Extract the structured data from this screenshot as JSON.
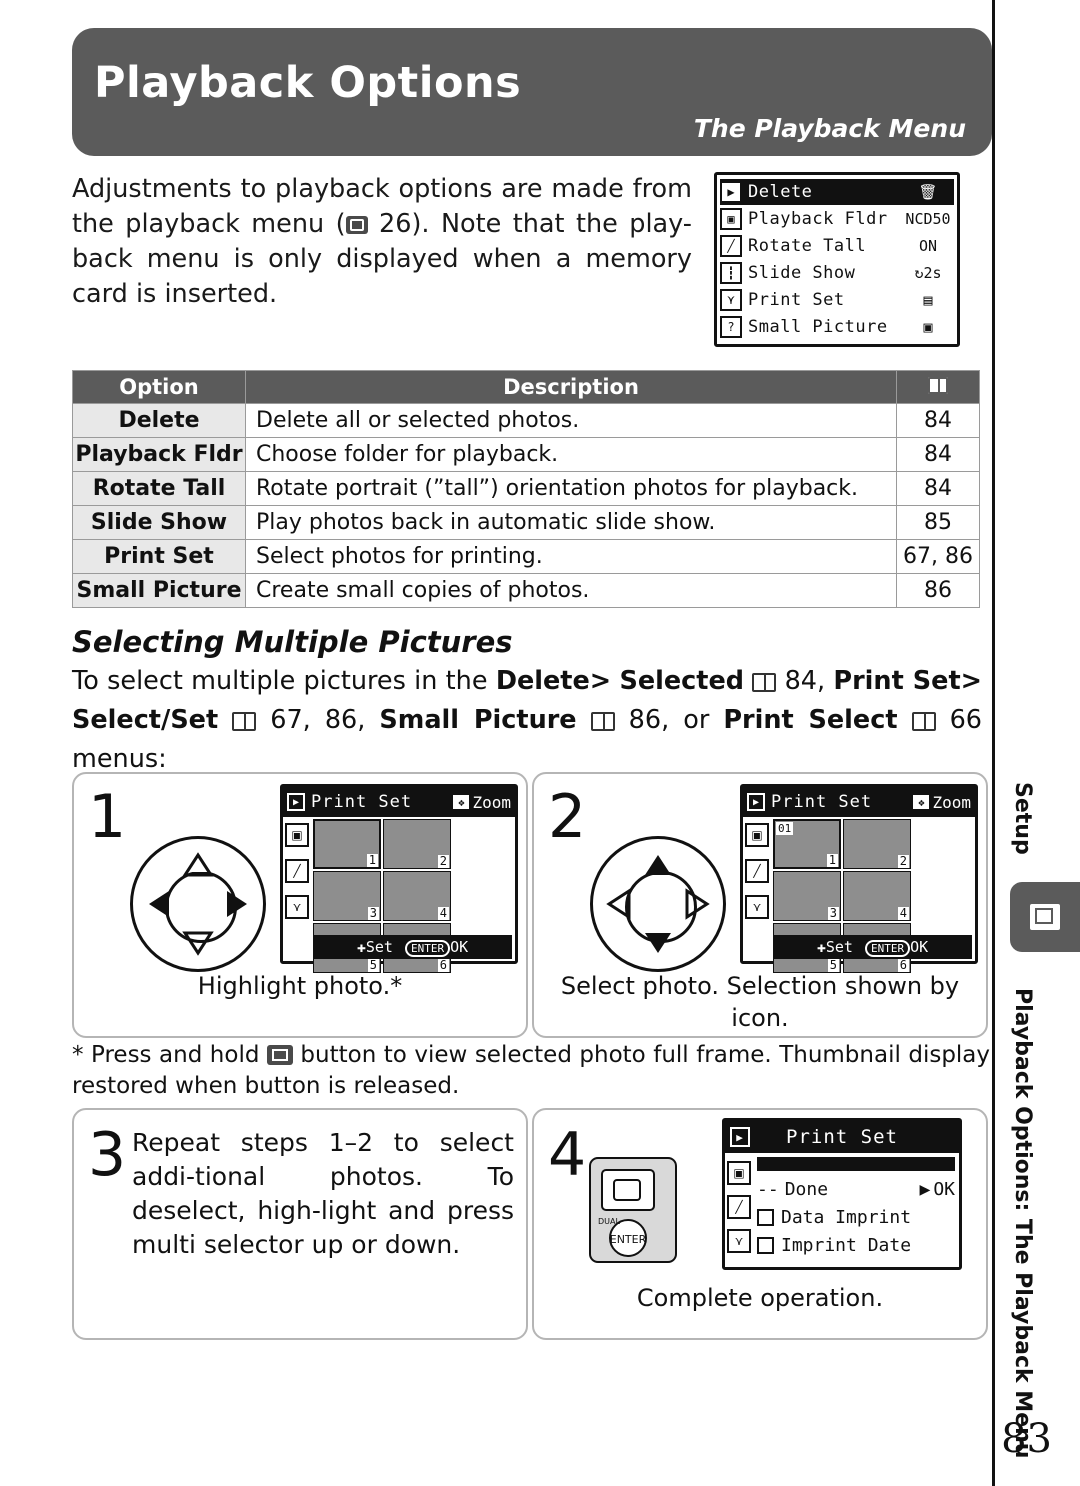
{
  "header": {
    "title": "Playback Options",
    "subtitle": "The Playback Menu"
  },
  "intro": {
    "text_before": "Adjustments to playback options are made from the playback menu (",
    "icon": "book-icon",
    "page_ref": "26",
    "text_after": ").  Note that the play-back menu is only displayed when a memory card is inserted."
  },
  "lcd_menu": {
    "rows": [
      {
        "icon": "playback-icon",
        "label": "Delete",
        "value": "trash",
        "selected": true
      },
      {
        "icon": "camera-icon",
        "label": "Playback Fldr",
        "value": "NCD50",
        "selected": false
      },
      {
        "icon": "pencil-icon",
        "label": "Rotate Tall",
        "value": "ON",
        "selected": false
      },
      {
        "icon": "menu-icon",
        "label": "Slide Show",
        "value": "2s",
        "selected": false
      },
      {
        "icon": "wrench-icon",
        "label": "Print Set",
        "value": "printer",
        "selected": false
      },
      {
        "icon": "question-icon",
        "label": "Small Picture",
        "value": "small",
        "selected": false
      }
    ]
  },
  "table": {
    "headers": {
      "option": "Option",
      "description": "Description",
      "page": "book-icon"
    },
    "rows": [
      {
        "option": "Delete",
        "description": "Delete all or selected photos.",
        "page": "84"
      },
      {
        "option": "Playback Fldr",
        "description": "Choose folder for playback.",
        "page": "84"
      },
      {
        "option": "Rotate Tall",
        "description": "Rotate portrait (”tall”) orientation photos for playback.",
        "page": "84"
      },
      {
        "option": "Slide Show",
        "description": "Play photos back in automatic slide show.",
        "page": "85"
      },
      {
        "option": "Print Set",
        "description": "Select photos for printing.",
        "page": "67, 86"
      },
      {
        "option": "Small Picture",
        "description": "Create small copies of photos.",
        "page": "86"
      }
    ]
  },
  "section": {
    "heading": "Selecting Multiple Pictures",
    "body_p1": "To select multiple pictures in the ",
    "b1": "Delete",
    "gt1": ">",
    "b2": "Selected",
    "pg1": "84",
    "b3": "Print Set",
    "gt2": ">",
    "b4": "Select/Set",
    "pg2": "67, 86",
    "b5": "Small Picture",
    "pg3": "86",
    "or_text": ", or ",
    "b6": "Print Select",
    "pg4": "66",
    "tail": "menus:"
  },
  "steps": [
    {
      "number": "1",
      "caption": "Highlight photo.*",
      "lcd": {
        "title": "Print Set",
        "zoom": "Zoom",
        "set_label": "Set",
        "enter_label": "ENTER",
        "ok_label": "OK",
        "thumbs": [
          {
            "n": "1",
            "badge": "",
            "selected": true
          },
          {
            "n": "2",
            "badge": "",
            "selected": false
          },
          {
            "n": "3",
            "badge": "",
            "selected": false
          },
          {
            "n": "4",
            "badge": "",
            "selected": false
          },
          {
            "n": "5",
            "badge": "",
            "selected": false
          },
          {
            "n": "6",
            "badge": "",
            "selected": false
          }
        ]
      }
    },
    {
      "number": "2",
      "caption": "Select photo.  Selection shown by icon.",
      "lcd": {
        "title": "Print Set",
        "zoom": "Zoom",
        "set_label": "Set",
        "enter_label": "ENTER",
        "ok_label": "OK",
        "thumbs": [
          {
            "n": "1",
            "badge": "01",
            "selected": true
          },
          {
            "n": "2",
            "badge": "",
            "selected": false
          },
          {
            "n": "3",
            "badge": "",
            "selected": false
          },
          {
            "n": "4",
            "badge": "",
            "selected": false
          },
          {
            "n": "5",
            "badge": "",
            "selected": false
          },
          {
            "n": "6",
            "badge": "",
            "selected": false
          }
        ]
      }
    },
    {
      "number": "3",
      "caption": "",
      "text": "Repeat steps 1–2 to select addi-tional photos.  To deselect, high-light and press multi selector up or down."
    },
    {
      "number": "4",
      "caption": "Complete operation.",
      "lcd": {
        "title": "Print Set",
        "rows": [
          {
            "label": "Done",
            "mark": "--",
            "right": "OK",
            "checkbox": false
          },
          {
            "label": "Data Imprint",
            "mark": "",
            "right": "",
            "checkbox": true
          },
          {
            "label": "Imprint Date",
            "mark": "",
            "right": "",
            "checkbox": true
          }
        ],
        "enter_label": "ENTER"
      }
    }
  ],
  "footnote": {
    "star": "*",
    "text_before": "Press and hold ",
    "icon": "thumbnail-button-icon",
    "text_after": " button to view selected photo full frame.  Thumbnail display restored when button is released."
  },
  "sidebar": {
    "setup_label": "Setup",
    "playback_label": "Playback Options: The Playback Menu",
    "tab_icon": "playback-tab-icon"
  },
  "page_number": "83"
}
